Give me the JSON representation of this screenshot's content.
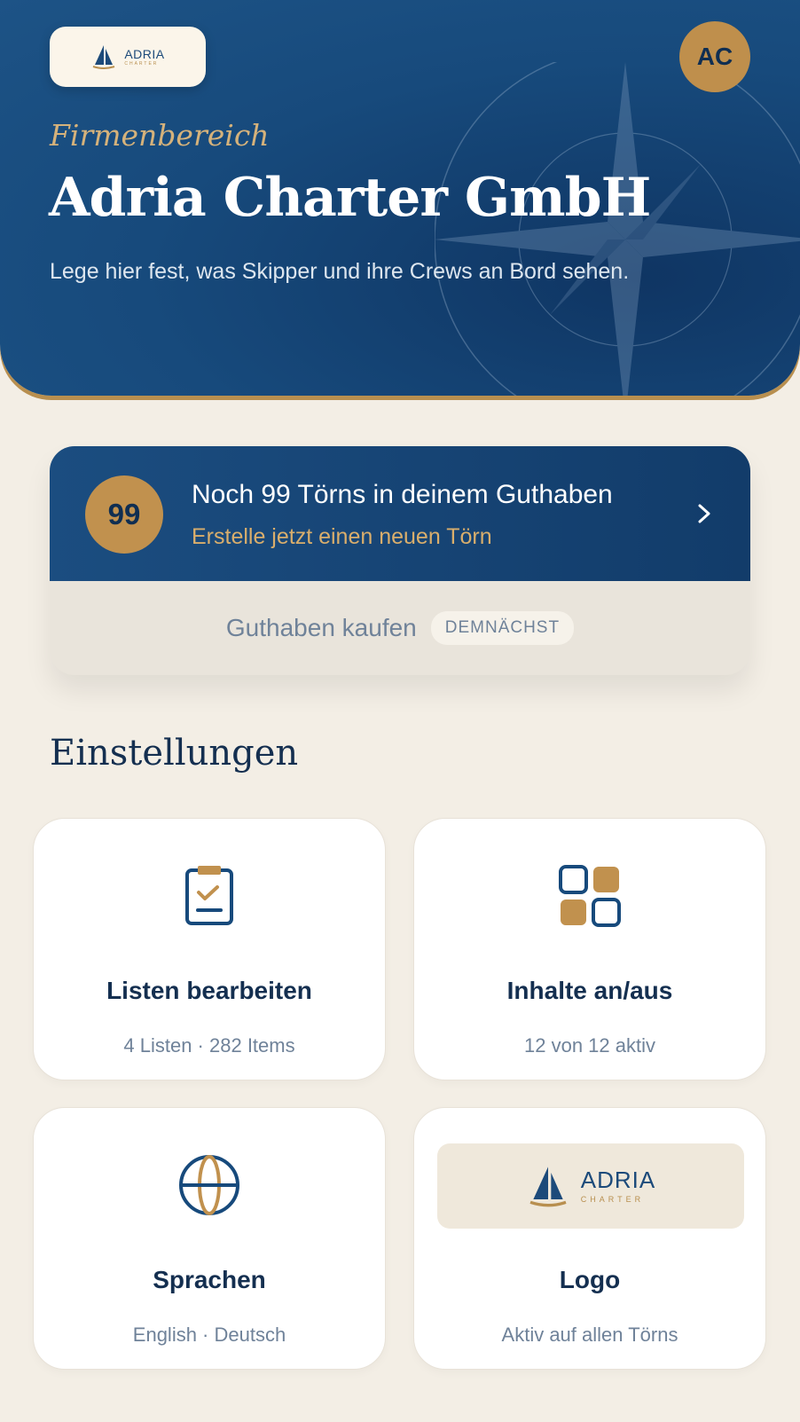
{
  "header": {
    "brand": {
      "name": "ADRIA",
      "tagline": "CHARTER"
    },
    "avatar_initials": "AC",
    "eyebrow": "Firmenbereich",
    "company_name": "Adria Charter GmbH",
    "subtitle": "Lege hier fest, was Skipper und ihre Crews an Bord sehen."
  },
  "credits": {
    "count": "99",
    "title": "Noch 99 Törns in deinem Guthaben",
    "subtitle": "Erstelle jetzt einen neuen Törn",
    "buy_label": "Guthaben kaufen",
    "soon_badge": "DEMNÄCHST"
  },
  "settings": {
    "title": "Einstellungen",
    "tiles": [
      {
        "icon": "clipboard-check-icon",
        "title": "Listen bearbeiten",
        "subtitle": "4 Listen · 282 Items"
      },
      {
        "icon": "grid-toggle-icon",
        "title": "Inhalte an/aus",
        "subtitle": "12 von 12 aktiv"
      },
      {
        "icon": "globe-icon",
        "title": "Sprachen",
        "subtitle": "English · Deutsch"
      },
      {
        "icon": "logo-preview",
        "title": "Logo",
        "subtitle": "Aktiv auf allen Törns"
      }
    ]
  },
  "colors": {
    "navy": "#174a7c",
    "gold": "#c1914e",
    "background": "#f3eee5"
  }
}
